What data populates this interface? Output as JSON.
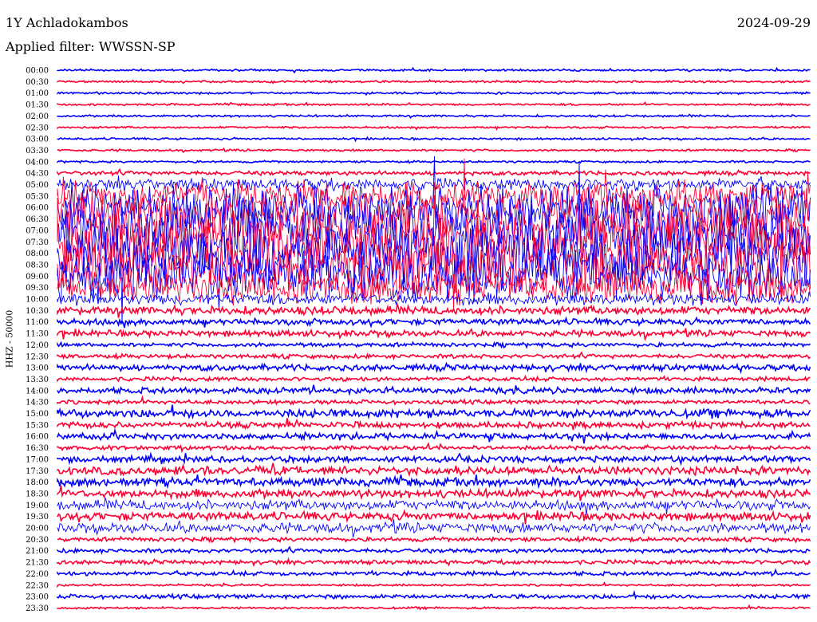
{
  "header": {
    "station": "1Y Achladokambos",
    "date": "2024-09-29",
    "filter": "Applied filter: WWSSN-SP"
  },
  "chart_data": {
    "type": "line",
    "title": "1Y Achladokambos",
    "ylabel": "HHZ - 50000",
    "colors": [
      "#0000ff",
      "#ff0033"
    ],
    "rows": [
      {
        "label": "00:00",
        "amp": 1
      },
      {
        "label": "00:30",
        "amp": 1
      },
      {
        "label": "01:00",
        "amp": 1
      },
      {
        "label": "01:30",
        "amp": 1
      },
      {
        "label": "02:00",
        "amp": 1
      },
      {
        "label": "02:30",
        "amp": 1
      },
      {
        "label": "03:00",
        "amp": 1
      },
      {
        "label": "03:30",
        "amp": 1
      },
      {
        "label": "04:00",
        "amp": 1
      },
      {
        "label": "04:30",
        "amp": 2
      },
      {
        "label": "05:00",
        "amp": 6
      },
      {
        "label": "05:30",
        "amp": 14
      },
      {
        "label": "06:00",
        "amp": 22
      },
      {
        "label": "06:30",
        "amp": 28
      },
      {
        "label": "07:00",
        "amp": 30
      },
      {
        "label": "07:30",
        "amp": 30
      },
      {
        "label": "08:00",
        "amp": 30
      },
      {
        "label": "08:30",
        "amp": 28
      },
      {
        "label": "09:00",
        "amp": 24
      },
      {
        "label": "09:30",
        "amp": 16
      },
      {
        "label": "10:00",
        "amp": 6
      },
      {
        "label": "10:30",
        "amp": 4
      },
      {
        "label": "11:00",
        "amp": 3
      },
      {
        "label": "11:30",
        "amp": 3
      },
      {
        "label": "12:00",
        "amp": 2
      },
      {
        "label": "12:30",
        "amp": 2
      },
      {
        "label": "13:00",
        "amp": 3
      },
      {
        "label": "13:30",
        "amp": 2
      },
      {
        "label": "14:00",
        "amp": 3
      },
      {
        "label": "14:30",
        "amp": 2
      },
      {
        "label": "15:00",
        "amp": 4
      },
      {
        "label": "15:30",
        "amp": 3
      },
      {
        "label": "16:00",
        "amp": 3
      },
      {
        "label": "16:30",
        "amp": 2
      },
      {
        "label": "17:00",
        "amp": 3
      },
      {
        "label": "17:30",
        "amp": 4
      },
      {
        "label": "18:00",
        "amp": 4
      },
      {
        "label": "18:30",
        "amp": 4
      },
      {
        "label": "19:00",
        "amp": 5
      },
      {
        "label": "19:30",
        "amp": 4
      },
      {
        "label": "20:00",
        "amp": 5
      },
      {
        "label": "20:30",
        "amp": 2
      },
      {
        "label": "21:00",
        "amp": 2
      },
      {
        "label": "21:30",
        "amp": 2
      },
      {
        "label": "22:00",
        "amp": 2
      },
      {
        "label": "22:30",
        "amp": 1
      },
      {
        "label": "23:00",
        "amp": 2
      },
      {
        "label": "23:30",
        "amp": 1
      }
    ]
  }
}
